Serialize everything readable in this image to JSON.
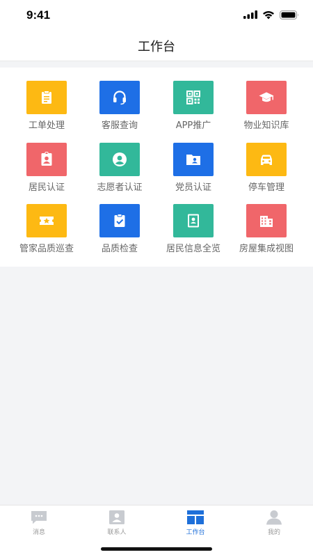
{
  "status_bar": {
    "time": "9:41"
  },
  "header": {
    "title": "工作台"
  },
  "colors": {
    "yellow": "#fdb913",
    "blue": "#1e6fe6",
    "teal": "#32b89a",
    "red": "#f0666a",
    "tab_active": "#1e6fd9",
    "tab_inactive": "#c8cbd0"
  },
  "grid": [
    {
      "label": "工单处理",
      "icon": "clipboard-icon",
      "color": "yellow"
    },
    {
      "label": "客服查询",
      "icon": "headset-icon",
      "color": "blue"
    },
    {
      "label": "APP推广",
      "icon": "qr-code-icon",
      "color": "teal"
    },
    {
      "label": "物业知识库",
      "icon": "graduation-cap-icon",
      "color": "red"
    },
    {
      "label": "居民认证",
      "icon": "id-badge-icon",
      "color": "red"
    },
    {
      "label": "志愿者认证",
      "icon": "user-circle-icon",
      "color": "teal"
    },
    {
      "label": "党员认证",
      "icon": "user-folder-icon",
      "color": "blue"
    },
    {
      "label": "停车管理",
      "icon": "car-icon",
      "color": "yellow"
    },
    {
      "label": "管家品质巡查",
      "icon": "star-ticket-icon",
      "color": "yellow"
    },
    {
      "label": "品质检查",
      "icon": "clipboard-check-icon",
      "color": "blue"
    },
    {
      "label": "居民信息全览",
      "icon": "contact-card-icon",
      "color": "teal"
    },
    {
      "label": "房屋集成视图",
      "icon": "building-icon",
      "color": "red"
    }
  ],
  "tabbar": [
    {
      "label": "消息",
      "icon": "message-icon",
      "active": false
    },
    {
      "label": "联系人",
      "icon": "contacts-icon",
      "active": false
    },
    {
      "label": "工作台",
      "icon": "workbench-icon",
      "active": true
    },
    {
      "label": "我的",
      "icon": "profile-icon",
      "active": false
    }
  ]
}
